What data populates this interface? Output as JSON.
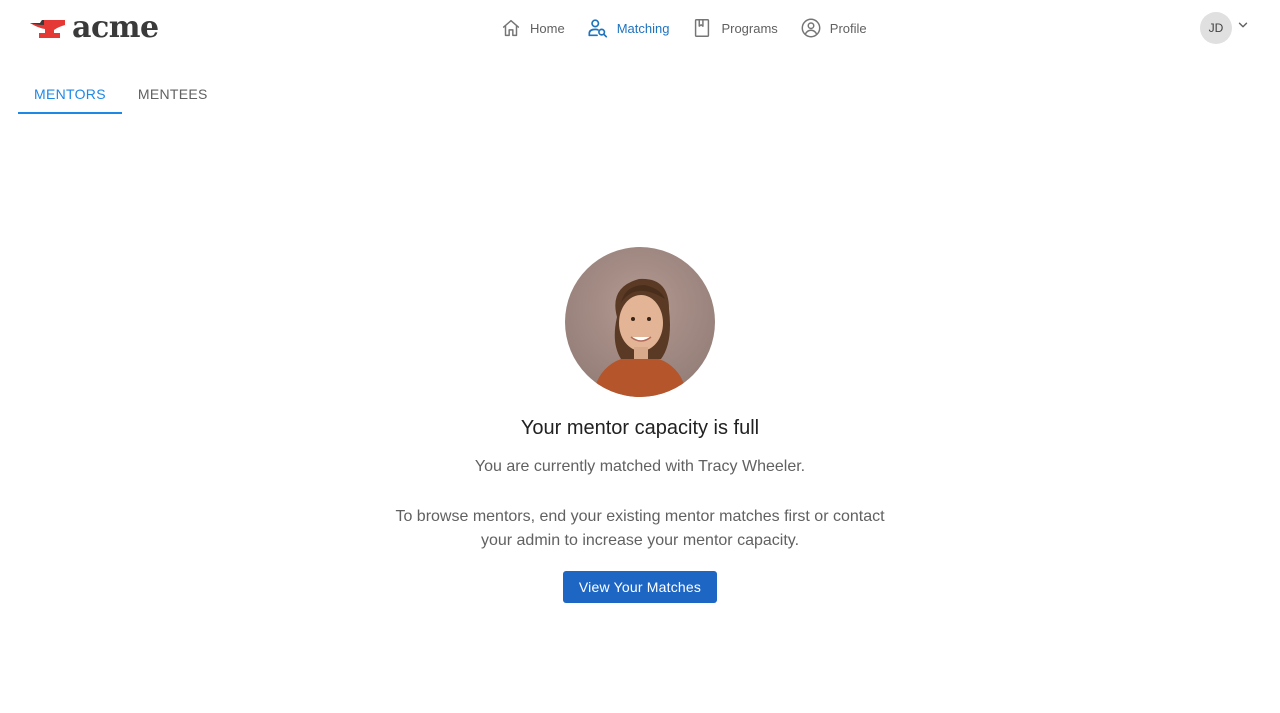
{
  "brand": {
    "name": "acme"
  },
  "nav": {
    "items": [
      {
        "label": "Home",
        "icon": "home-icon",
        "active": false
      },
      {
        "label": "Matching",
        "icon": "person-search-icon",
        "active": true
      },
      {
        "label": "Programs",
        "icon": "bookmark-book-icon",
        "active": false
      },
      {
        "label": "Profile",
        "icon": "account-circle-icon",
        "active": false
      }
    ]
  },
  "user": {
    "initials": "JD",
    "menu_icon": "chevron-down-icon"
  },
  "tabs": [
    {
      "label": "MENTORS",
      "active": true
    },
    {
      "label": "MENTEES",
      "active": false
    }
  ],
  "empty_state": {
    "image": "mentor-profile-photo",
    "title": "Your mentor capacity is full",
    "subtitle": "You are currently matched with Tracy Wheeler.",
    "description": "To browse mentors, end your existing mentor matches first or contact your admin to increase your mentor capacity.",
    "button_label": "View Your Matches"
  },
  "colors": {
    "accent": "#1e88e5",
    "button": "#1e66c4",
    "logo_red": "#e53935",
    "text_muted": "#616161"
  }
}
